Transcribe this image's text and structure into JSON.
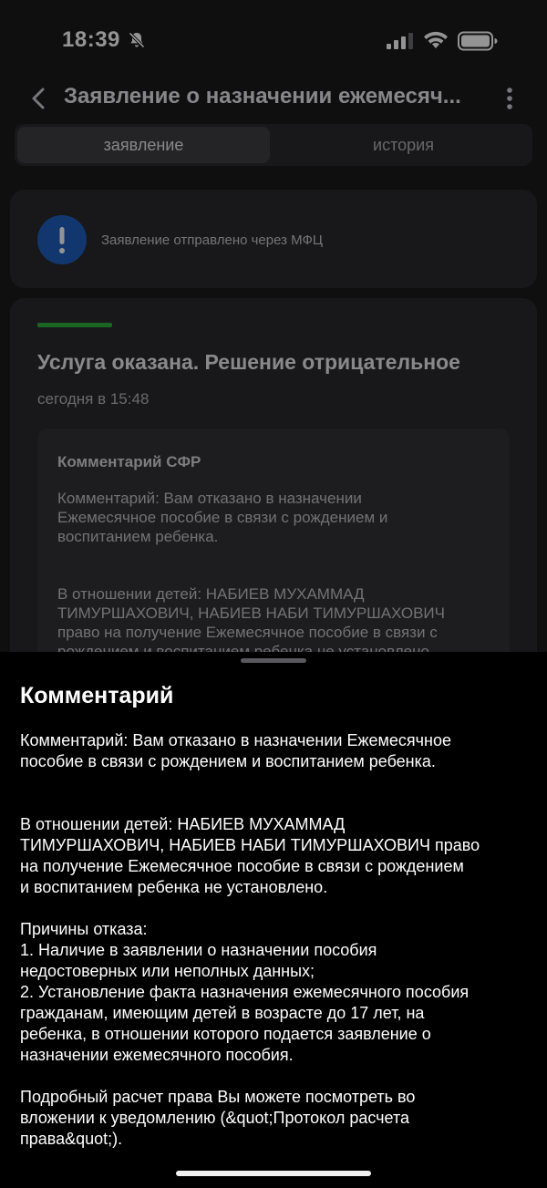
{
  "status_bar": {
    "time": "18:39"
  },
  "nav": {
    "title": "Заявление о назначении ежемесяч..."
  },
  "tabs": [
    {
      "label": "заявление",
      "active": true
    },
    {
      "label": "история",
      "active": false
    }
  ],
  "notice": {
    "text": "Заявление отправлено через МФЦ",
    "icon": "exclamation-icon",
    "icon_color": "#1f5fbd"
  },
  "status_card": {
    "accent_color": "#2fae3d",
    "title": "Услуга оказана. Решение отрицательное",
    "date": "сегодня в 15:48",
    "comment_title": "Комментарий СФР",
    "comment_text": "Комментарий: Вам отказано в назначении\nЕжемесячное пособие в связи с рождением и\nвоспитанием ребенка.\n\n\nВ отношении детей: НАБИЕВ МУХАММАД\nТИМУРШАХОВИЧ, НАБИЕВ НАБИ ТИМУРШАХОВИЧ\nправо на получение Ежемесячное пособие в связи с\nрождением и воспитанием ребенка не установлено"
  },
  "sheet": {
    "title": "Комментарий",
    "text": "Комментарий: Вам отказано в назначении Ежемесячное\nпособие в связи с рождением и воспитанием ребенка.\n\n\nВ отношении детей: НАБИЕВ МУХАММАД\nТИМУРШАХОВИЧ, НАБИЕВ НАБИ ТИМУРШАХОВИЧ право\nна получение Ежемесячное пособие в связи с рождением\nи воспитанием ребенка не установлено.\n\nПричины отказа:\n1. Наличие в заявлении о назначении пособия\nнедостоверных или неполных данных;\n2. Установление факта назначения ежемесячного пособия\nгражданам, имеющим детей в возрасте до 17 лет, на\nребенка, в отношении которого подается заявление о\nназначении ежемесячного пособия.\n\nПодробный расчет права Вы можете посмотреть во\nвложении к уведомлению (&quot;Протокол расчета\nправа&quot;)."
  }
}
